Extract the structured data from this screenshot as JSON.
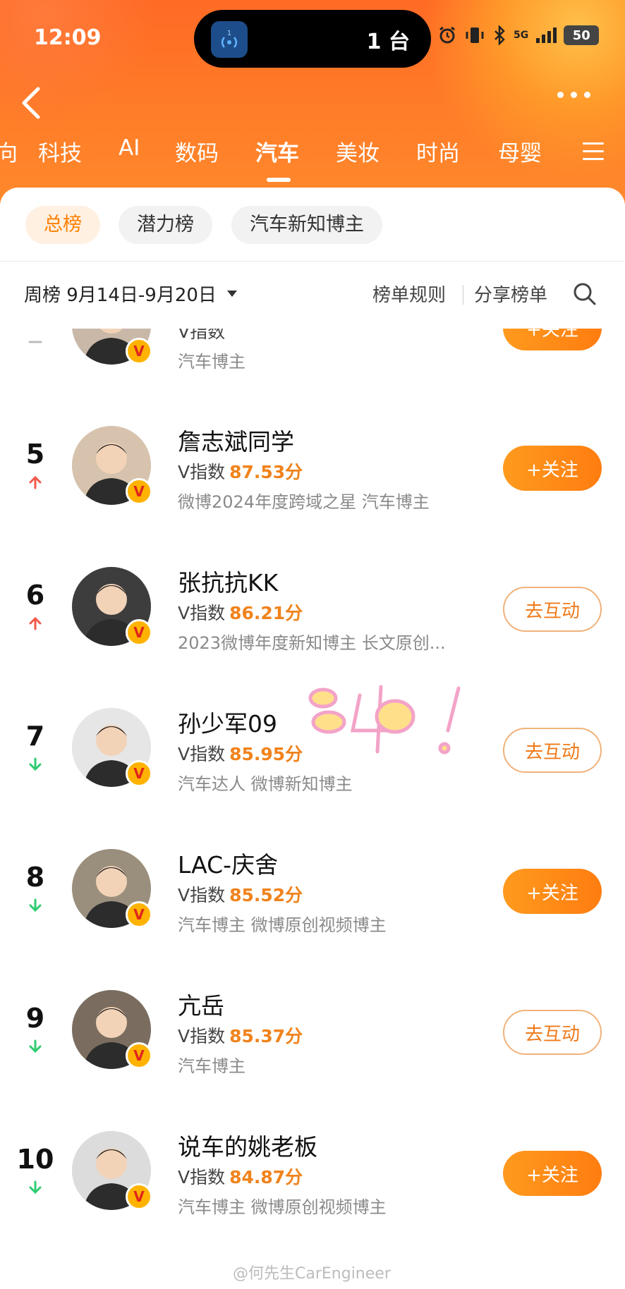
{
  "status_bar": {
    "time": "12:09",
    "island_badge": "1",
    "island_text": "1 台",
    "network": "5G",
    "battery": "50"
  },
  "category_tabs": [
    {
      "label": "科技",
      "active": false
    },
    {
      "label": "AI",
      "active": false
    },
    {
      "label": "数码",
      "active": false
    },
    {
      "label": "汽车",
      "active": true
    },
    {
      "label": "美妆",
      "active": false
    },
    {
      "label": "时尚",
      "active": false
    },
    {
      "label": "母婴",
      "active": false
    }
  ],
  "sub_tabs": [
    {
      "label": "总榜",
      "active": true
    },
    {
      "label": "潜力榜",
      "active": false
    },
    {
      "label": "汽车新知博主",
      "active": false
    }
  ],
  "week_bar": {
    "label": "周榜 9月14日-9月20日",
    "rules": "榜单规则",
    "share": "分享榜单"
  },
  "rankings": [
    {
      "rank": "",
      "trend": "same",
      "name": "",
      "score_label": "V指数",
      "score": "",
      "tags": "汽车博主",
      "button": "+关注",
      "button_type": "follow"
    },
    {
      "rank": "5",
      "trend": "up",
      "name": "詹志斌同学",
      "score_label": "V指数",
      "score": "87.53分",
      "tags": "微博2024年度跨域之星 汽车博主",
      "button": "+关注",
      "button_type": "follow"
    },
    {
      "rank": "6",
      "trend": "up",
      "name": "张抗抗KK",
      "score_label": "V指数",
      "score": "86.21分",
      "tags": "2023微博年度新知博主 长文原创...",
      "button": "去互动",
      "button_type": "interact"
    },
    {
      "rank": "7",
      "trend": "down",
      "name": "孙少军09",
      "score_label": "V指数",
      "score": "85.95分",
      "tags": "汽车达人 微博新知博主",
      "button": "去互动",
      "button_type": "interact"
    },
    {
      "rank": "8",
      "trend": "down",
      "name": "LAC-庆舍",
      "score_label": "V指数",
      "score": "85.52分",
      "tags": "汽车博主 微博原创视频博主",
      "button": "+关注",
      "button_type": "follow"
    },
    {
      "rank": "9",
      "trend": "down",
      "name": "亢岳",
      "score_label": "V指数",
      "score": "85.37分",
      "tags": "汽车博主",
      "button": "去互动",
      "button_type": "interact"
    },
    {
      "rank": "10",
      "trend": "down",
      "name": "说车的姚老板",
      "score_label": "V指数",
      "score": "84.87分",
      "tags": "汽车博主 微博原创视频博主",
      "button": "+关注",
      "button_type": "follow"
    }
  ],
  "watermark": "@何先生CarEngineer",
  "colors": {
    "accent": "#ff8000",
    "score": "#f0831c",
    "up": "#f2594b",
    "down": "#2ecc71",
    "header": "#ff7a28"
  }
}
